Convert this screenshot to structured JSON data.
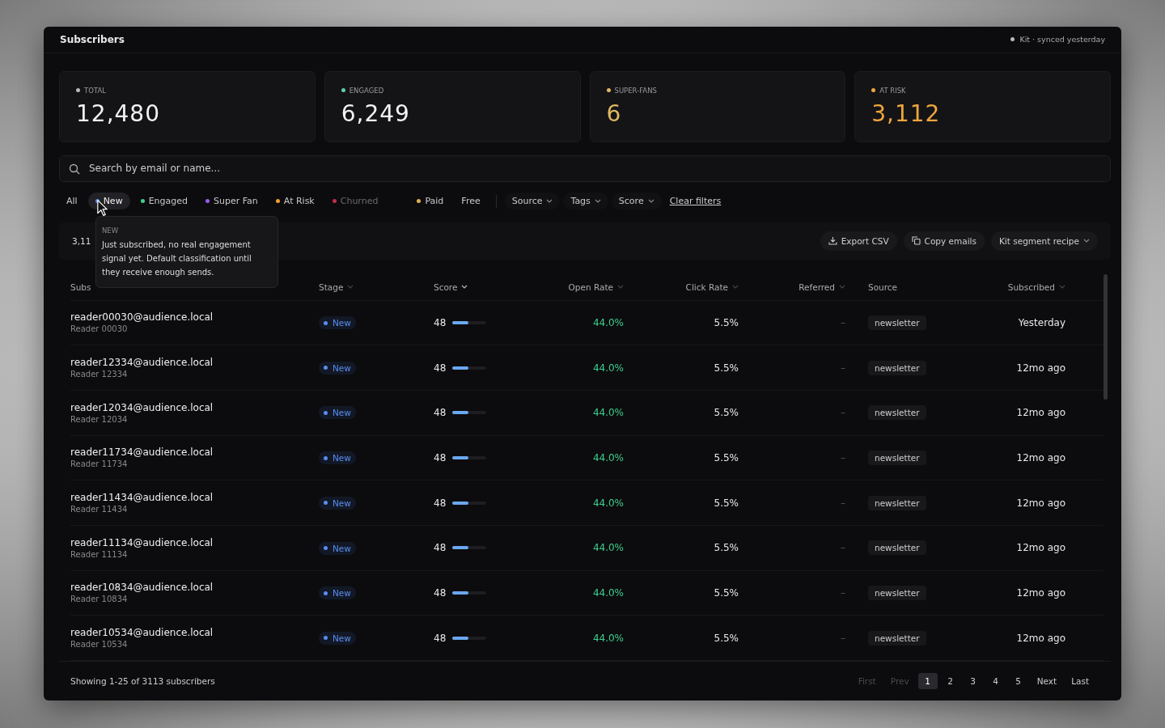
{
  "window": {
    "title": "Subscribers",
    "sync_status": "Kit · synced yesterday"
  },
  "stats": [
    {
      "label": "TOTAL",
      "value": "12,480",
      "color": "#b8b8bc"
    },
    {
      "label": "ENGAGED",
      "value": "6,249",
      "color": "#5fd0a8"
    },
    {
      "label": "SUPER-FANS",
      "value": "6",
      "color": "#e0b860"
    },
    {
      "label": "AT RISK",
      "value": "3,112",
      "color": "#f0a63c"
    }
  ],
  "search": {
    "placeholder": "Search by email or name..."
  },
  "filters": [
    {
      "label": "All",
      "selected": false,
      "disabled": false
    },
    {
      "label": "New",
      "selected": true,
      "disabled": false,
      "color": "#5b8def"
    },
    {
      "label": "Engaged",
      "selected": false,
      "disabled": false,
      "color": "#3ecf8e"
    },
    {
      "label": "Super Fan",
      "selected": false,
      "disabled": false,
      "color": "#9b59f0"
    },
    {
      "label": "At Risk",
      "selected": false,
      "disabled": false,
      "color": "#f0a030"
    },
    {
      "label": "Churned",
      "selected": false,
      "disabled": true,
      "color": "#c0304a"
    },
    {
      "label": "Paid",
      "selected": false,
      "disabled": false,
      "color": "#e0b050"
    },
    {
      "label": "Free",
      "selected": false,
      "disabled": false
    }
  ],
  "dropdowns": [
    "Source",
    "Tags",
    "Score"
  ],
  "clear_filters": "Clear filters",
  "tooltip": {
    "title": "NEW",
    "text": "Just subscribed, no real engagement signal yet. Default classification until they receive enough sends."
  },
  "toolbar": {
    "count": "3,11",
    "actions": [
      {
        "kind": "export",
        "label": "Export CSV"
      },
      {
        "kind": "copy",
        "label": "Copy emails"
      },
      {
        "kind": "menu",
        "label": "Kit segment recipe"
      }
    ]
  },
  "table": {
    "columns": [
      "Subs",
      "Stage",
      "Score",
      "Open Rate",
      "Click Rate",
      "Referred",
      "Source",
      "Subscribed"
    ],
    "rows": [
      {
        "email": "reader00030@audience.local",
        "name": "Reader 00030",
        "stage": "New",
        "score": "48",
        "level": 0.48,
        "open_rate": "44.0%",
        "click_rate": "5.5%",
        "referred": "–",
        "source": "newsletter",
        "subscribed": "Yesterday"
      },
      {
        "email": "reader12334@audience.local",
        "name": "Reader 12334",
        "stage": "New",
        "score": "48",
        "level": 0.48,
        "open_rate": "44.0%",
        "click_rate": "5.5%",
        "referred": "–",
        "source": "newsletter",
        "subscribed": "12mo ago"
      },
      {
        "email": "reader12034@audience.local",
        "name": "Reader 12034",
        "stage": "New",
        "score": "48",
        "level": 0.48,
        "open_rate": "44.0%",
        "click_rate": "5.5%",
        "referred": "–",
        "source": "newsletter",
        "subscribed": "12mo ago"
      },
      {
        "email": "reader11734@audience.local",
        "name": "Reader 11734",
        "stage": "New",
        "score": "48",
        "level": 0.48,
        "open_rate": "44.0%",
        "click_rate": "5.5%",
        "referred": "–",
        "source": "newsletter",
        "subscribed": "12mo ago"
      },
      {
        "email": "reader11434@audience.local",
        "name": "Reader 11434",
        "stage": "New",
        "score": "48",
        "level": 0.48,
        "open_rate": "44.0%",
        "click_rate": "5.5%",
        "referred": "–",
        "source": "newsletter",
        "subscribed": "12mo ago"
      },
      {
        "email": "reader11134@audience.local",
        "name": "Reader 11134",
        "stage": "New",
        "score": "48",
        "level": 0.48,
        "open_rate": "44.0%",
        "click_rate": "5.5%",
        "referred": "–",
        "source": "newsletter",
        "subscribed": "12mo ago"
      },
      {
        "email": "reader10834@audience.local",
        "name": "Reader 10834",
        "stage": "New",
        "score": "48",
        "level": 0.48,
        "open_rate": "44.0%",
        "click_rate": "5.5%",
        "referred": "–",
        "source": "newsletter",
        "subscribed": "12mo ago"
      },
      {
        "email": "reader10534@audience.local",
        "name": "Reader 10534",
        "stage": "New",
        "score": "48",
        "level": 0.48,
        "open_rate": "44.0%",
        "click_rate": "5.5%",
        "referred": "–",
        "source": "newsletter",
        "subscribed": "12mo ago"
      }
    ]
  },
  "footer": {
    "summary": "Showing 1-25 of 3113 subscribers",
    "pages": [
      {
        "label": "First",
        "selected": false,
        "disabled": true
      },
      {
        "label": "Prev",
        "selected": false,
        "disabled": true
      },
      {
        "label": "1",
        "selected": true,
        "disabled": false
      },
      {
        "label": "2",
        "selected": false,
        "disabled": false
      },
      {
        "label": "3",
        "selected": false,
        "disabled": false
      },
      {
        "label": "4",
        "selected": false,
        "disabled": false
      },
      {
        "label": "5",
        "selected": false,
        "disabled": false
      },
      {
        "label": "Next",
        "selected": false,
        "disabled": false
      },
      {
        "label": "Last",
        "selected": false,
        "disabled": false
      }
    ]
  }
}
